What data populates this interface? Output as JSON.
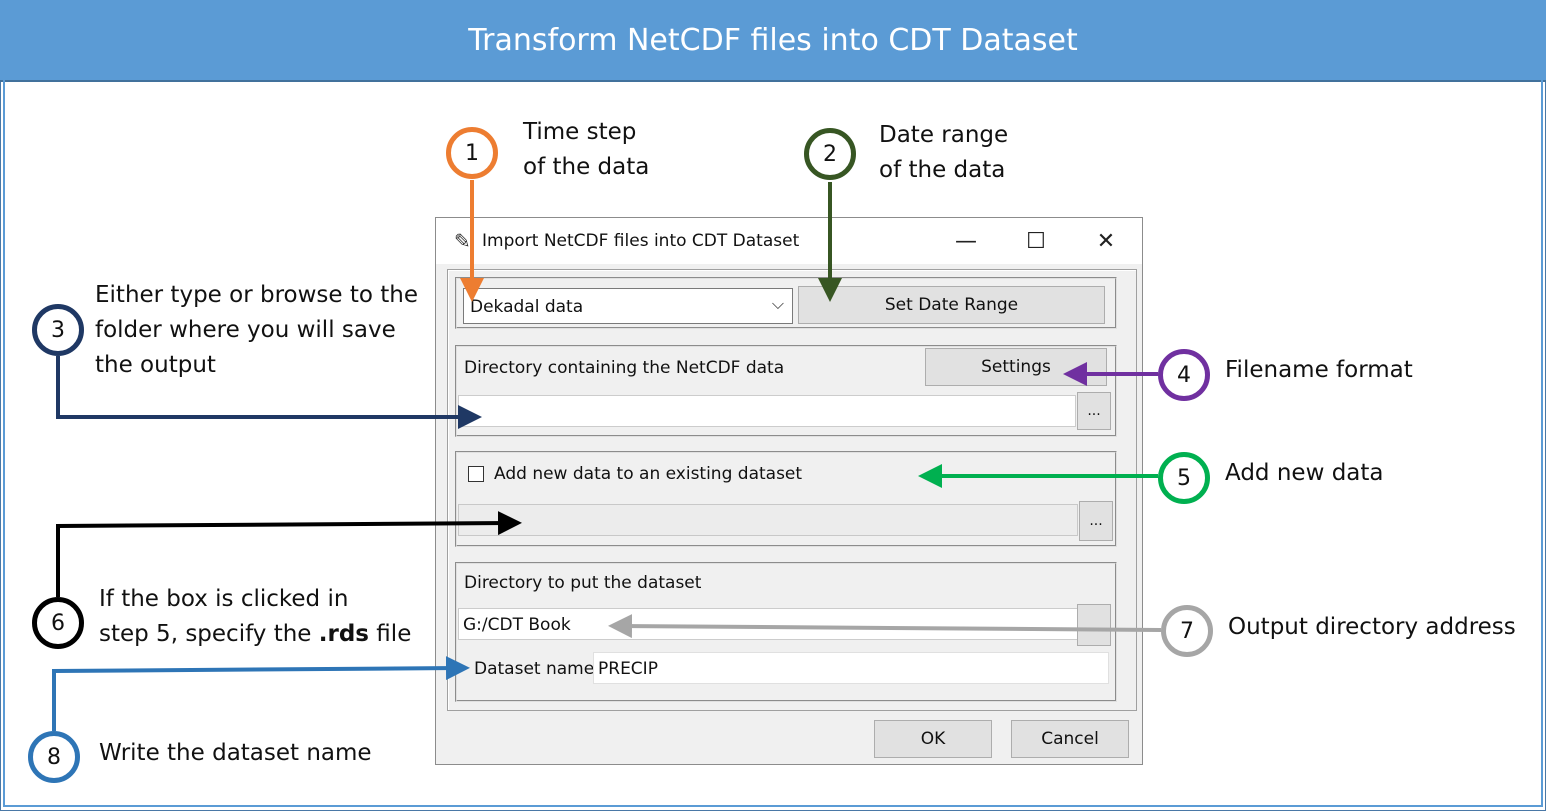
{
  "banner": {
    "title": "Transform NetCDF files into CDT Dataset"
  },
  "annotations": [
    {
      "number": "1",
      "color": "#ed7d31",
      "lines": [
        "Time step",
        "of the data"
      ]
    },
    {
      "number": "2",
      "color": "#375623",
      "lines": [
        "Date range",
        "of the data"
      ]
    },
    {
      "number": "3",
      "color": "#1f3864",
      "lines": [
        "Either type or browse to the",
        "folder where you will save",
        "the output"
      ]
    },
    {
      "number": "4",
      "color": "#7030a0",
      "lines": [
        "Filename format"
      ]
    },
    {
      "number": "5",
      "color": "#00b050",
      "lines": [
        "Add new data"
      ]
    },
    {
      "number": "6",
      "color": "#000000",
      "lines": [
        "If the box is clicked in",
        "step 5, specify the ",
        ".rds",
        " file"
      ]
    },
    {
      "number": "7",
      "color": "#a6a6a6",
      "lines": [
        "Output directory address"
      ]
    },
    {
      "number": "8",
      "color": "#2e75b6",
      "lines": [
        "Write the dataset name"
      ]
    }
  ],
  "dialog": {
    "title": "Import NetCDF files into CDT Dataset",
    "title_icon": "feather-icon",
    "minimize": "—",
    "maximize": "☐",
    "close": "✕",
    "timestep_value": "Dekadal data",
    "timestep_chevron": "⌵",
    "set_date_range_label": "Set Date Range",
    "netcdf_dir_label": "Directory containing the NetCDF data",
    "settings_label": "Settings",
    "netcdf_dir_value": "",
    "browse_label": "...",
    "add_new_label": "Add new data to an existing dataset",
    "add_new_checked": false,
    "existing_dataset_value": "",
    "output_dir_label": "Directory to put the dataset",
    "output_dir_value": "G:/CDT Book",
    "dataset_name_label": "Dataset name",
    "dataset_name_value": "PRECIP",
    "ok_label": "OK",
    "cancel_label": "Cancel"
  }
}
